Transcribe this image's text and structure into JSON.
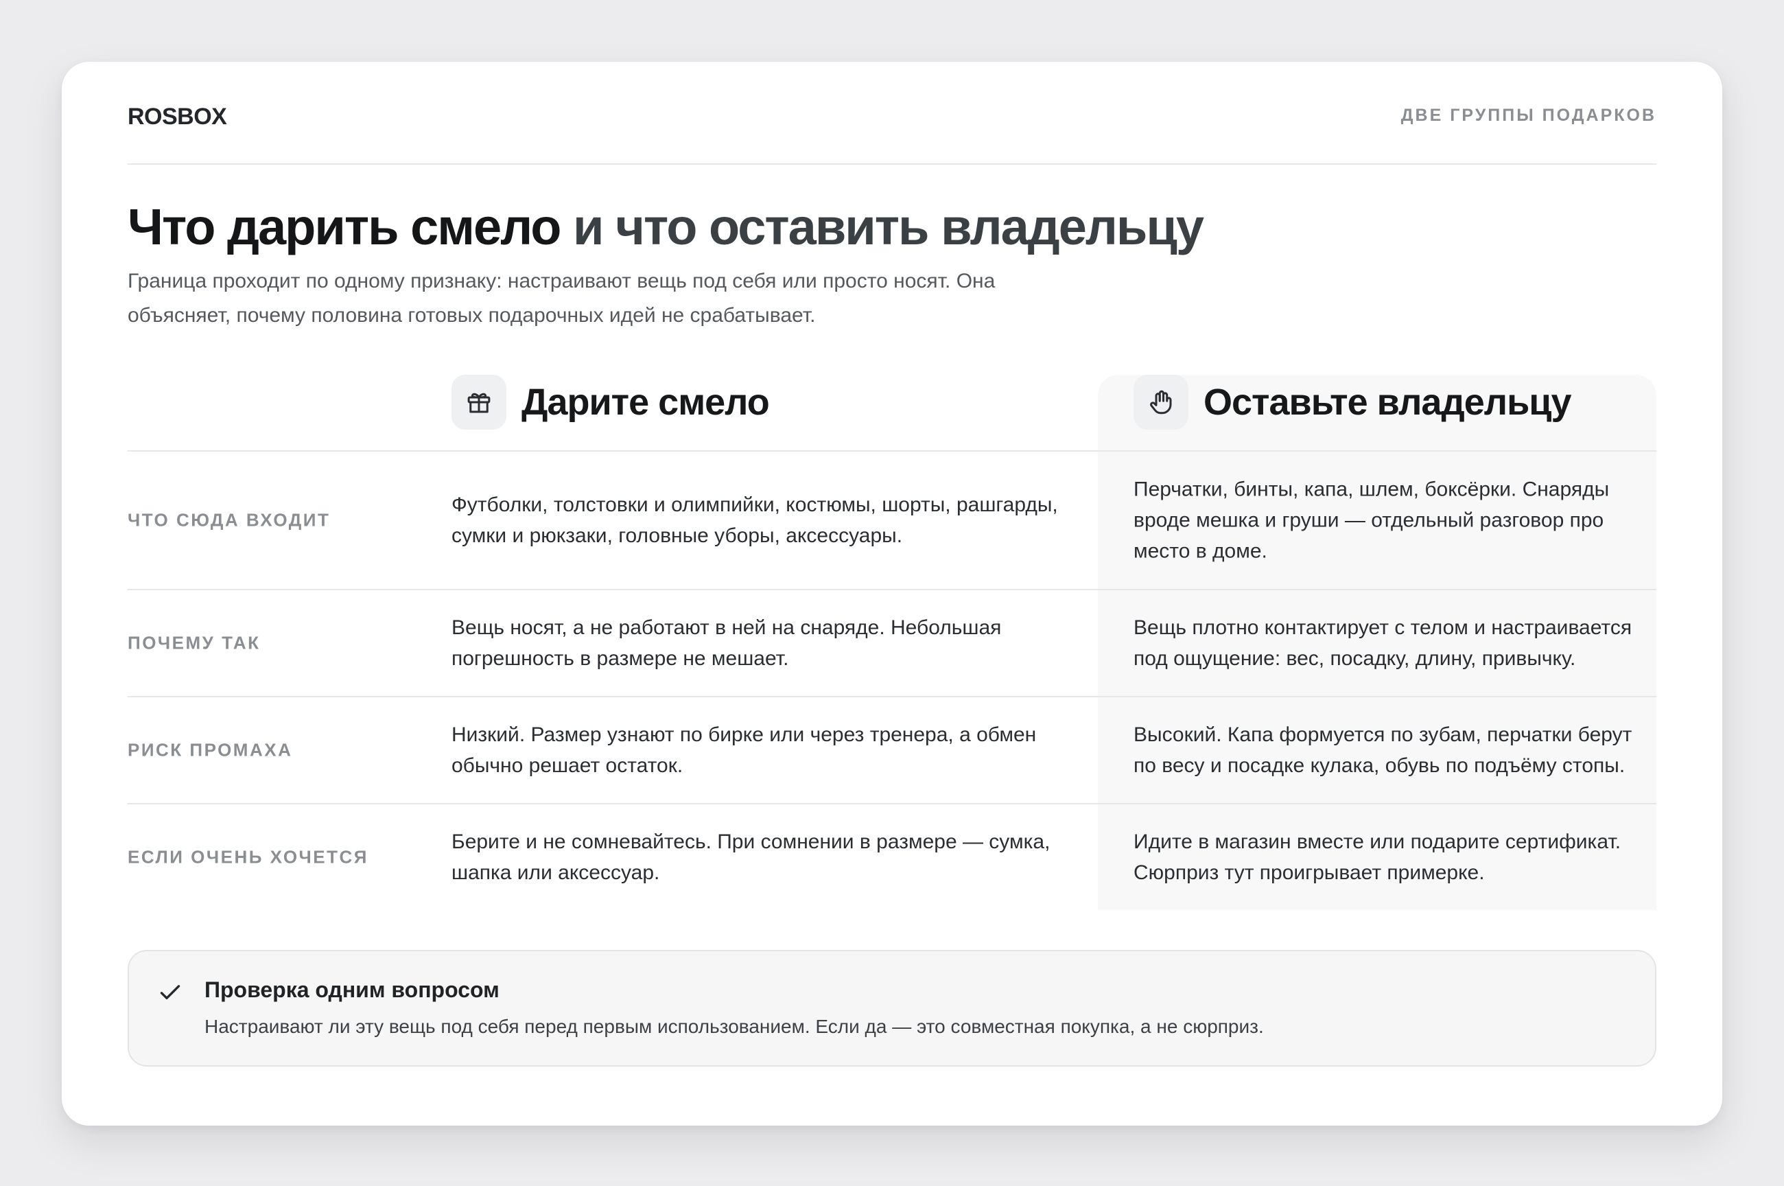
{
  "header": {
    "brand": "ROSBOX",
    "section_label": "ДВЕ ГРУППЫ ПОДАРКОВ"
  },
  "hero": {
    "title_strong": "Что дарить смело",
    "title_muted": " и что оставить владельцу",
    "lead": "Граница проходит по одному признаку: настраивают вещь под себя или просто носят. Она объясняет, почему половина готовых подарочных идей не срабатывает."
  },
  "columns": {
    "gift": {
      "title": "Дарите смело",
      "icon": "gift-icon"
    },
    "owner": {
      "title": "Оставьте владельцу",
      "icon": "hand-icon"
    }
  },
  "rows": [
    {
      "label": "ЧТО СЮДА ВХОДИТ",
      "gift": "Футболки, толстовки и олимпийки, костюмы, шорты, рашгарды, сумки и рюкзаки, головные уборы, аксессуары.",
      "owner": "Перчатки, бинты, капа, шлем, боксёрки. Снаряды вроде мешка и груши — отдельный разговор про место в доме."
    },
    {
      "label": "ПОЧЕМУ ТАК",
      "gift": "Вещь носят, а не работают в ней на снаряде. Небольшая погрешность в размере не мешает.",
      "owner": "Вещь плотно контактирует с телом и настраивается под ощущение: вес, посадку, длину, привычку."
    },
    {
      "label": "РИСК ПРОМАХА",
      "gift": "Низкий. Размер узнают по бирке или через тренера, а обмен обычно решает остаток.",
      "owner": "Высокий. Капа формуется по зубам, перчатки берут по весу и посадке кулака, обувь по подъёму стопы."
    },
    {
      "label": "ЕСЛИ ОЧЕНЬ ХОЧЕТСЯ",
      "gift": "Берите и не сомневайтесь. При сомнении в размере — сумка, шапка или аксессуар.",
      "owner": "Идите в магазин вместе или подарите сертификат. Сюрприз тут проигрывает примерке."
    }
  ],
  "callout": {
    "icon": "check-icon",
    "title": "Проверка одним вопросом",
    "text": "Настраивают ли эту вещь под себя перед первым использованием. Если да — это совместная покупка, а не сюрприз."
  }
}
